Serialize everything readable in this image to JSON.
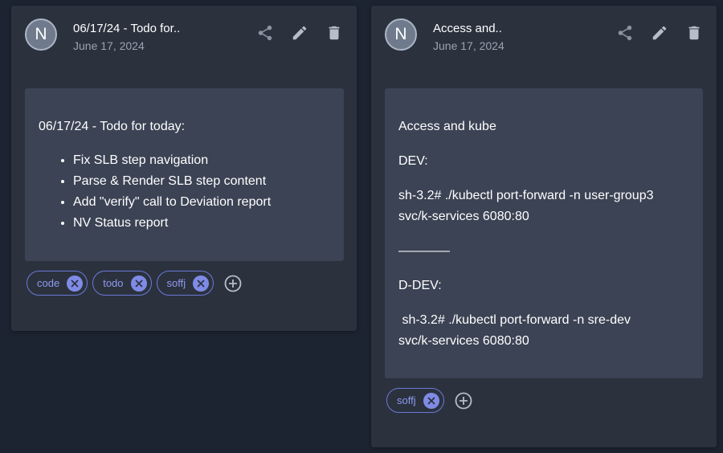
{
  "colors": {
    "background": "#1c2331",
    "card": "#2b323e",
    "content": "#3b4354",
    "tag_accent": "#7f8be6",
    "icon": "#9aa3b1"
  },
  "cards": [
    {
      "avatar": "N",
      "title": "06/17/24 - Todo for..",
      "date": "June 17, 2024",
      "content": {
        "heading": "06/17/24 - Todo for today:",
        "items": [
          "Fix SLB step navigation",
          "Parse & Render SLB step content",
          "Add \"verify\" call to Deviation report",
          "NV Status report"
        ]
      },
      "tags": [
        "code",
        "todo",
        "soffj"
      ]
    },
    {
      "avatar": "N",
      "title": "Access and..",
      "date": "June 17, 2024",
      "content": {
        "lines": [
          "Access and kube",
          "DEV:",
          "sh-3.2# ./kubectl port-forward -n user-group3",
          "svc/k-services 6080:80",
          "————",
          "D-DEV:",
          " sh-3.2# ./kubectl port-forward -n sre-dev",
          "svc/k-services 6080:80"
        ]
      },
      "tags": [
        "soffj"
      ]
    }
  ],
  "icons": [
    "share-icon",
    "edit-icon",
    "delete-icon",
    "close-icon",
    "add-circle-icon"
  ]
}
